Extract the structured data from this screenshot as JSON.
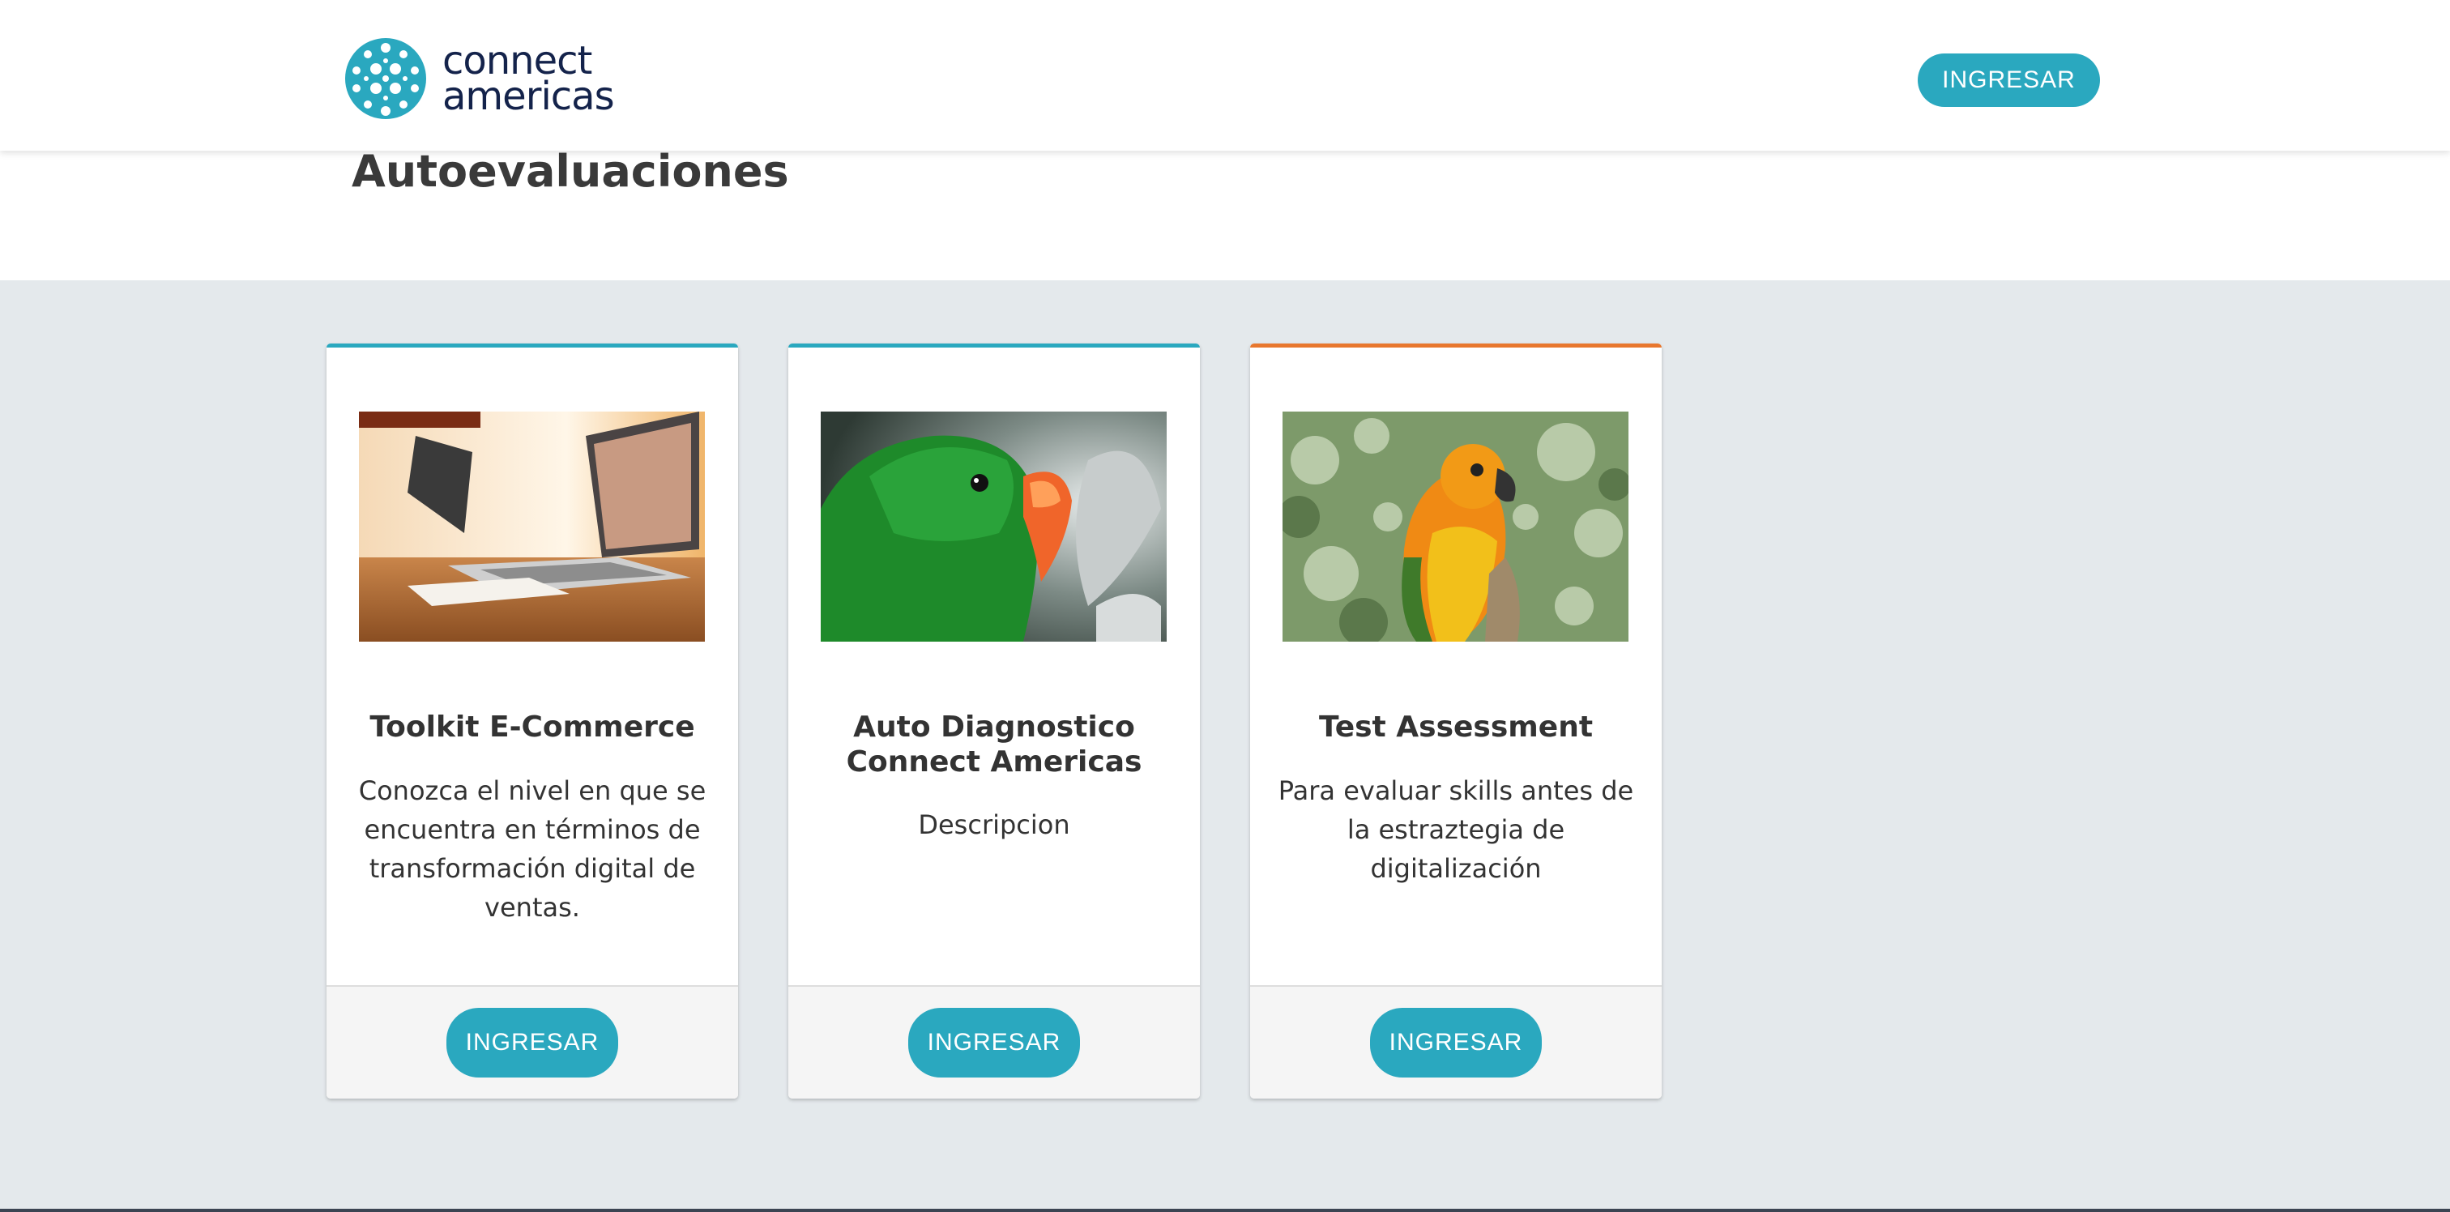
{
  "header": {
    "logo": {
      "line1": "connect",
      "line2": "americas",
      "icon": "connect-americas-globe-icon"
    },
    "login_button": "INGRESAR"
  },
  "page": {
    "title": "Autoevaluaciones"
  },
  "colors": {
    "accent": "#2aa8bf",
    "card_top_teal": "#2aa8bf",
    "card_top_orange": "#e8772e",
    "section_bg": "#e4e9ec",
    "logo_text": "#14234b"
  },
  "cards": [
    {
      "title": "Toolkit E-Commerce",
      "description": "Conozca el nivel en que se encuentra en términos de transformación digital de ventas.",
      "button": "INGRESAR",
      "image": "laptop-desk-photo",
      "accent": "#2aa8bf"
    },
    {
      "title": "Auto Diagnostico Connect Americas",
      "description": "Descripcion",
      "button": "INGRESAR",
      "image": "green-parrot-photo",
      "accent": "#2aa8bf"
    },
    {
      "title": "Test Assessment",
      "description": "Para evaluar skills antes de la estraztegia de digitalización",
      "button": "INGRESAR",
      "image": "orange-parakeet-photo",
      "accent": "#e8772e"
    }
  ]
}
